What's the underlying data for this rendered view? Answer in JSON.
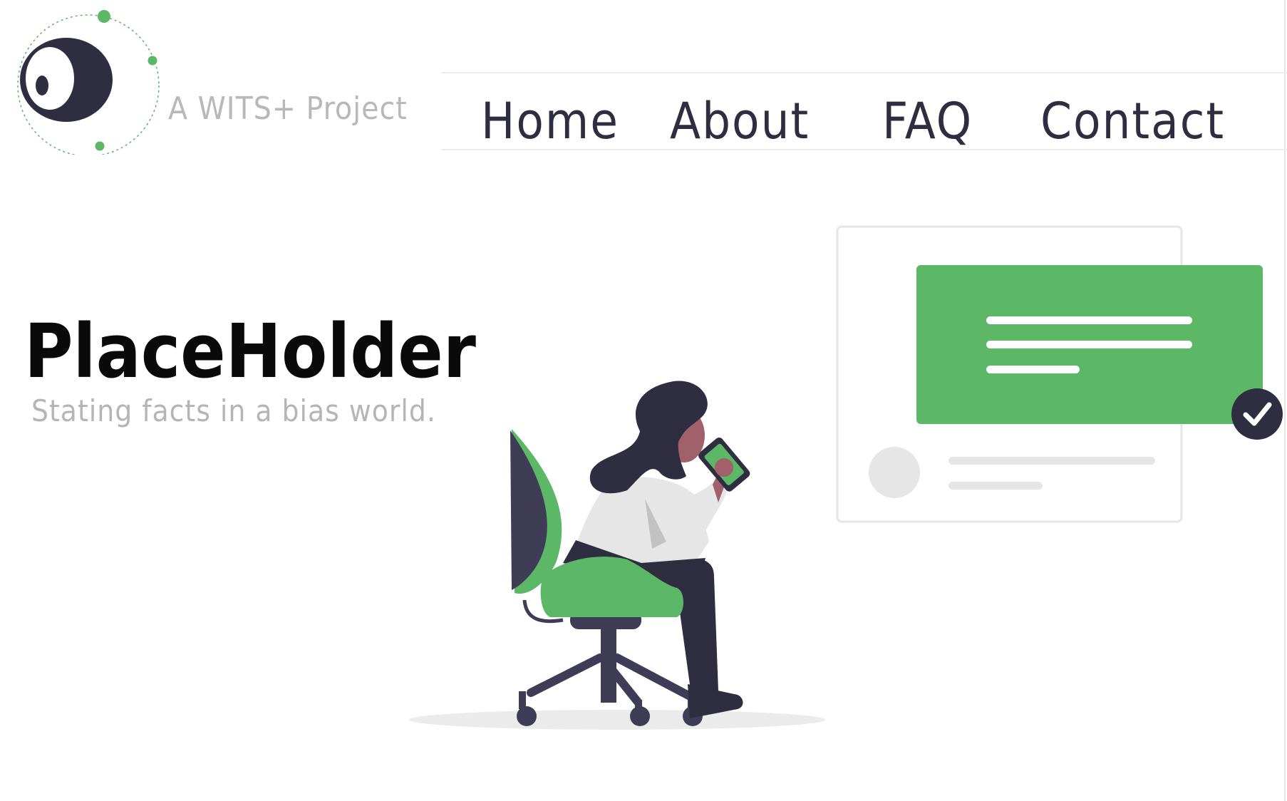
{
  "brand": {
    "tagline": "A WITS+ Project",
    "logo_icon": "eye-planet-icon"
  },
  "nav": {
    "items": [
      {
        "label": "Home"
      },
      {
        "label": "About"
      },
      {
        "label": "FAQ"
      },
      {
        "label": "Contact"
      }
    ]
  },
  "hero": {
    "title": "PlaceHolder",
    "subtitle": "Stating facts in a bias world."
  },
  "colors": {
    "accent_green": "#5cb867",
    "dark": "#2f2e41",
    "muted_text": "#b5b5b5",
    "divider": "#ececec"
  },
  "illustration": {
    "icon": "woman-on-chair-with-phone-illustration",
    "card_icon": "message-card-icon",
    "badge_icon": "checkmark-badge-icon"
  }
}
